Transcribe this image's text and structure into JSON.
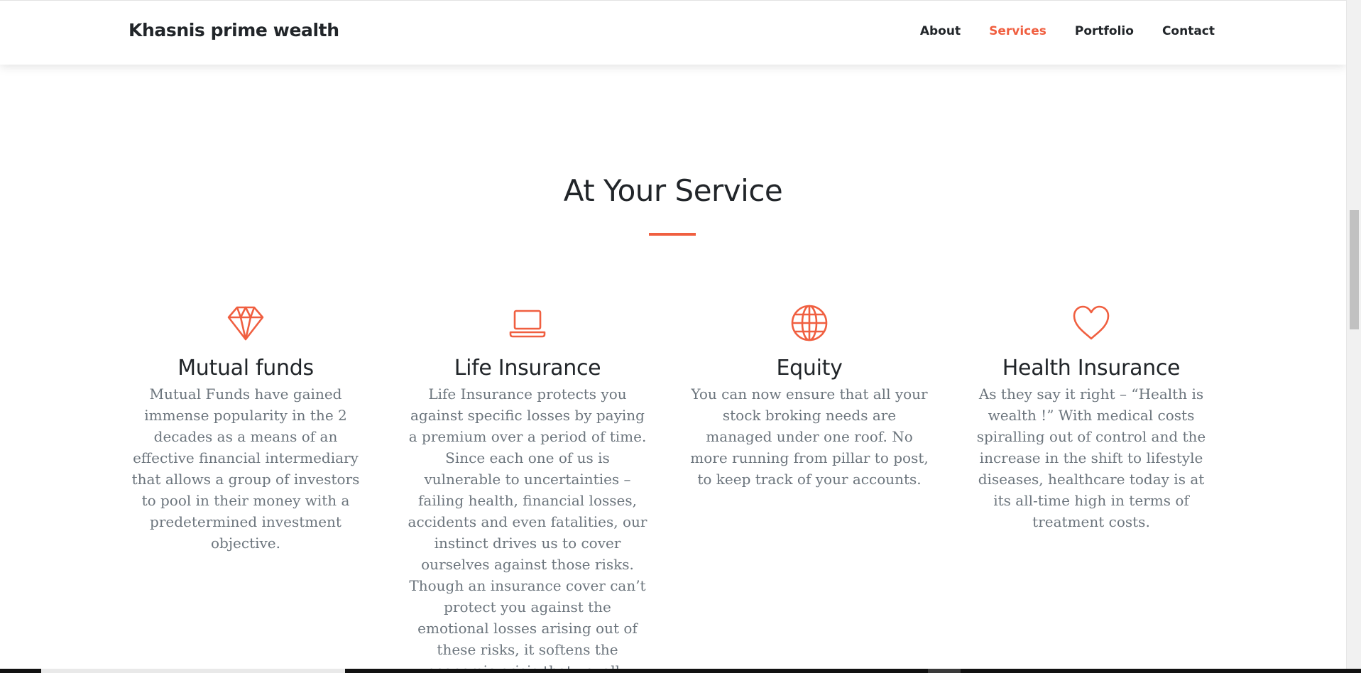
{
  "navbar": {
    "brand": "Khasnis prime wealth",
    "links": [
      {
        "label": "About",
        "active": false
      },
      {
        "label": "Services",
        "active": true
      },
      {
        "label": "Portfolio",
        "active": false
      },
      {
        "label": "Contact",
        "active": false
      }
    ]
  },
  "section": {
    "title": "At Your Service"
  },
  "services": [
    {
      "icon": "diamond-icon",
      "title": "Mutual funds",
      "text": "Mutual Funds have gained immense popularity in the 2 decades as a means of an effective financial intermediary that allows a group of investors to pool in their money with a predetermined investment objective."
    },
    {
      "icon": "laptop-icon",
      "title": "Life Insurance",
      "text": "Life Insurance protects you against specific losses by paying a premium over a period of time. Since each one of us is vulnerable to uncertainties – failing health, financial losses, accidents and even fatalities, our instinct drives us to cover ourselves against those risks. Though an insurance cover can’t protect you against the emotional losses arising out of these risks, it softens the economic crisis that usually"
    },
    {
      "icon": "globe-icon",
      "title": "Equity",
      "text": "You can now ensure that all your stock broking needs are managed under one roof. No more running from pillar to post, to keep track of your accounts."
    },
    {
      "icon": "heart-icon",
      "title": "Health Insurance",
      "text": "As they say it right – “Health is wealth !” With medical costs spiralling out of control and the increase in the shift to lifestyle diseases, healthcare today is at its all-time high in terms of treatment costs."
    }
  ],
  "colors": {
    "accent": "#f05f40",
    "heading": "#212529",
    "body_text": "#6c757d"
  }
}
